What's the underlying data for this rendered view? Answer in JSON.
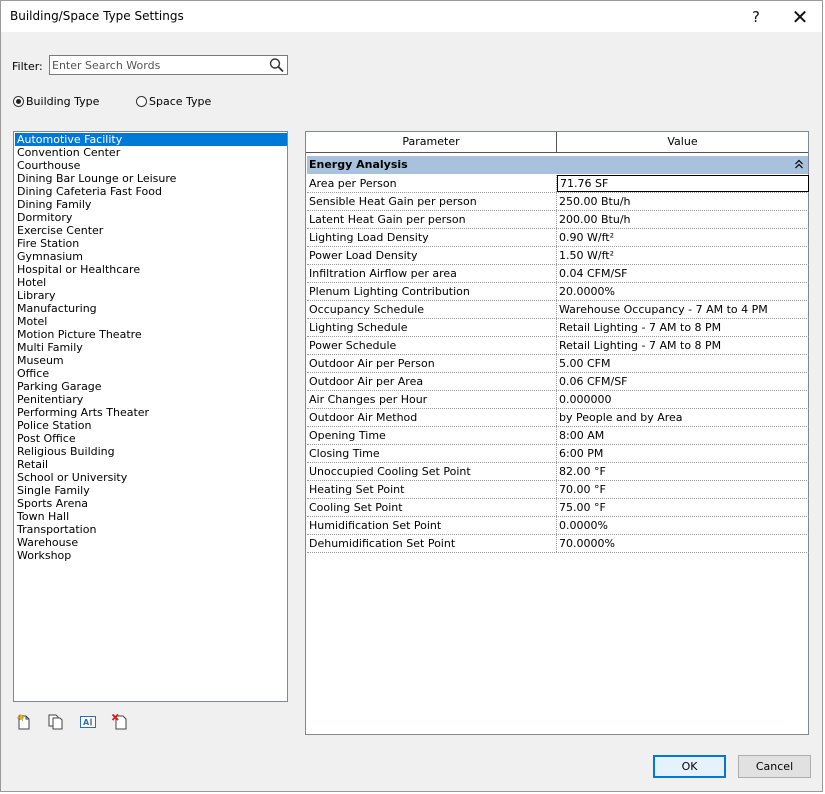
{
  "window": {
    "title": "Building/Space Type Settings",
    "help_glyph": "?",
    "close_glyph": "✕"
  },
  "filter": {
    "label": "Filter:",
    "placeholder": "Enter Search Words"
  },
  "type_mode": {
    "building_label": "Building Type",
    "space_label": "Space Type",
    "selected": "Building Type"
  },
  "building_types": [
    "Automotive Facility",
    "Convention Center",
    "Courthouse",
    "Dining Bar Lounge or Leisure",
    "Dining Cafeteria Fast Food",
    "Dining Family",
    "Dormitory",
    "Exercise Center",
    "Fire Station",
    "Gymnasium",
    "Hospital or Healthcare",
    "Hotel",
    "Library",
    "Manufacturing",
    "Motel",
    "Motion Picture Theatre",
    "Multi Family",
    "Museum",
    "Office",
    "Parking Garage",
    "Penitentiary",
    "Performing Arts Theater",
    "Police Station",
    "Post Office",
    "Religious Building",
    "Retail",
    "School or University",
    "Single Family",
    "Sports Arena",
    "Town Hall",
    "Transportation",
    "Warehouse",
    "Workshop"
  ],
  "selected_type": "Automotive Facility",
  "grid": {
    "header_parameter": "Parameter",
    "header_value": "Value",
    "group": "Energy Analysis",
    "rows": [
      {
        "parameter": "Area per Person",
        "value": "71.76 SF"
      },
      {
        "parameter": "Sensible Heat Gain per person",
        "value": "250.00 Btu/h"
      },
      {
        "parameter": "Latent Heat Gain per person",
        "value": "200.00 Btu/h"
      },
      {
        "parameter": "Lighting Load Density",
        "value": "0.90 W/ft²"
      },
      {
        "parameter": "Power Load Density",
        "value": "1.50 W/ft²"
      },
      {
        "parameter": "Infiltration Airflow per area",
        "value": "0.04 CFM/SF"
      },
      {
        "parameter": "Plenum Lighting Contribution",
        "value": "20.0000%"
      },
      {
        "parameter": "Occupancy Schedule",
        "value": "Warehouse Occupancy - 7 AM to 4 PM"
      },
      {
        "parameter": "Lighting Schedule",
        "value": "Retail Lighting - 7 AM to 8 PM"
      },
      {
        "parameter": "Power Schedule",
        "value": "Retail Lighting - 7 AM to 8 PM"
      },
      {
        "parameter": "Outdoor Air per Person",
        "value": "5.00 CFM"
      },
      {
        "parameter": "Outdoor Air per Area",
        "value": "0.06 CFM/SF"
      },
      {
        "parameter": "Air Changes per Hour",
        "value": "0.000000"
      },
      {
        "parameter": "Outdoor Air Method",
        "value": "by People and by Area"
      },
      {
        "parameter": "Opening Time",
        "value": "8:00 AM"
      },
      {
        "parameter": "Closing Time",
        "value": "6:00 PM"
      },
      {
        "parameter": "Unoccupied Cooling Set Point",
        "value": "82.00 °F"
      },
      {
        "parameter": "Heating Set Point",
        "value": "70.00 °F"
      },
      {
        "parameter": "Cooling Set Point",
        "value": "75.00 °F"
      },
      {
        "parameter": "Humidification Set Point",
        "value": "0.0000%"
      },
      {
        "parameter": "Dehumidification Set Point",
        "value": "70.0000%"
      }
    ]
  },
  "list_tools": [
    "new-type-icon",
    "duplicate-type-icon",
    "rename-type-icon",
    "delete-type-icon"
  ],
  "buttons": {
    "ok": "OK",
    "cancel": "Cancel"
  },
  "colors": {
    "selection": "#0078d7",
    "group_header": "#a8c1dc"
  }
}
